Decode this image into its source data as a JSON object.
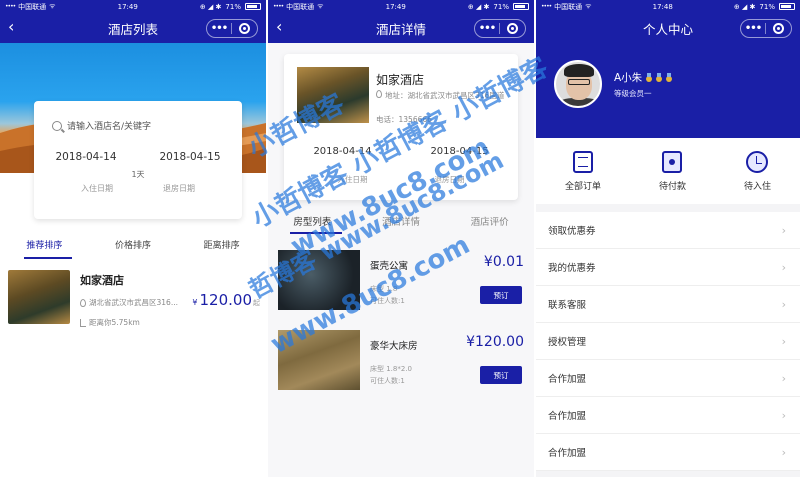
{
  "status_bar": {
    "carrier": "中国联通",
    "signal": "••••",
    "wifi": "ᯤ",
    "time": "17:49",
    "time3": "17:48",
    "battery": "71%",
    "icons": "⊕ ◢ ✱"
  },
  "nav": {
    "back_icon": "‹",
    "menu_dots": "•••"
  },
  "screen1": {
    "title": "酒店列表",
    "search_placeholder": "请输入酒店名/关键字",
    "check_in": "2018-04-14",
    "check_out": "2018-04-15",
    "nights": "1天",
    "check_in_label": "入住日期",
    "check_out_label": "退房日期",
    "sort_tabs": [
      "推荐排序",
      "价格排序",
      "距离排序"
    ],
    "hotel": {
      "name": "如家酒店",
      "address": "湖北省武汉市武昌区316...",
      "price_currency": "¥",
      "price": "120.00",
      "price_unit": "起",
      "distance": "距离你5.75km"
    }
  },
  "screen2": {
    "title": "酒店详情",
    "hotel_name": "如家酒店",
    "address": "地址：湖北省武汉市武昌区316国道",
    "phone": "电话：1356666",
    "check_in": "2018-04-14",
    "check_out": "2018-04-15",
    "check_in_label": "入住日期",
    "check_out_label": "退房日期",
    "tabs": [
      "房型列表",
      "酒店详情",
      "酒店评价"
    ],
    "rooms": [
      {
        "name": "蛋壳公寓",
        "bed": "床型 1.8",
        "capacity": "可住人数:1",
        "price": "¥0.01",
        "book": "预订"
      },
      {
        "name": "豪华大床房",
        "bed": "床型 1.8*2.0",
        "capacity": "可住人数:1",
        "price": "¥120.00",
        "book": "预订"
      }
    ]
  },
  "screen3": {
    "title": "个人中心",
    "user_name": "A小朱",
    "level": "等级会员一",
    "orders": [
      {
        "icon": "order-list-icon",
        "label": "全部订单"
      },
      {
        "icon": "wallet-icon",
        "label": "待付款"
      },
      {
        "icon": "clock-icon",
        "label": "待入住"
      }
    ],
    "menu": [
      "领取优惠券",
      "我的优惠券",
      "联系客服",
      "授权管理",
      "合作加盟",
      "合作加盟",
      "合作加盟"
    ]
  },
  "watermark": {
    "line1": "小哲博客",
    "line2": "小哲博客 小哲博客 小哲博客",
    "line3": "www.8uc8.com",
    "line4": "哲博客 www.8uc8.com",
    "line5": "www.8uc8.com"
  },
  "colors": {
    "primary": "#1a1fa6",
    "watermark": "#2878dc"
  }
}
